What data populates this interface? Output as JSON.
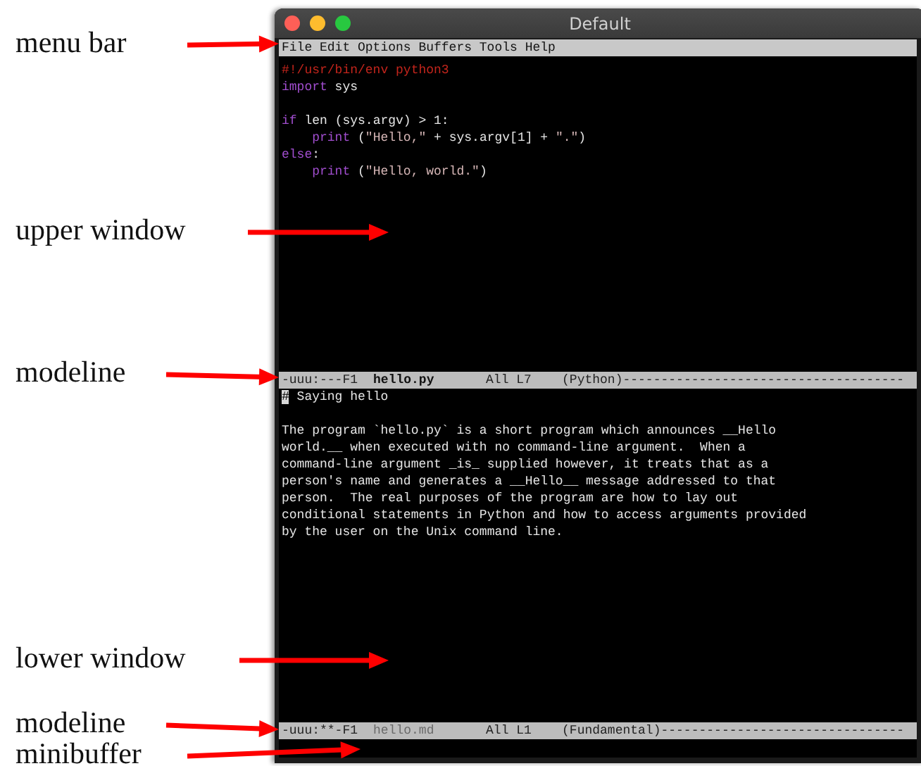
{
  "annotations": [
    {
      "label": "menu bar"
    },
    {
      "label": "upper window"
    },
    {
      "label": "modeline"
    },
    {
      "label": "lower window"
    },
    {
      "label": "modeline"
    },
    {
      "label": "minibuffer"
    }
  ],
  "window": {
    "title": "Default"
  },
  "menu_bar": [
    "File",
    "Edit",
    "Options",
    "Buffers",
    "Tools",
    "Help"
  ],
  "upper_window": {
    "lines": [
      {
        "kind": "code",
        "indent": false,
        "tokens": [
          {
            "kind": "comment",
            "text": "#!/usr/bin/env python3"
          }
        ]
      },
      {
        "kind": "code",
        "indent": false,
        "tokens": [
          {
            "kind": "keyword",
            "text": "import"
          },
          {
            "kind": "plain",
            "text": " sys"
          }
        ]
      },
      {
        "kind": "blank"
      },
      {
        "kind": "code",
        "indent": false,
        "tokens": [
          {
            "kind": "keyword",
            "text": "if"
          },
          {
            "kind": "plain",
            "text": " len (sys.argv) > 1:"
          }
        ]
      },
      {
        "kind": "code",
        "indent": true,
        "tokens": [
          {
            "kind": "keyword",
            "text": "print"
          },
          {
            "kind": "plain",
            "text": " ("
          },
          {
            "kind": "string",
            "text": "\"Hello,\""
          },
          {
            "kind": "plain",
            "text": " + sys.argv[1] + "
          },
          {
            "kind": "string",
            "text": "\".\""
          },
          {
            "kind": "plain",
            "text": ")"
          }
        ]
      },
      {
        "kind": "code",
        "indent": false,
        "tokens": [
          {
            "kind": "keyword",
            "text": "else"
          },
          {
            "kind": "plain",
            "text": ":"
          }
        ]
      },
      {
        "kind": "code",
        "indent": true,
        "tokens": [
          {
            "kind": "keyword",
            "text": "print"
          },
          {
            "kind": "plain",
            "text": " ("
          },
          {
            "kind": "string",
            "text": "\"Hello, world.\""
          },
          {
            "kind": "plain",
            "text": ")"
          }
        ]
      }
    ]
  },
  "upper_modeline": {
    "status": "-uuu:---F1",
    "buffer": "hello.py",
    "active": true,
    "position": "All L7",
    "mode": "(Python)",
    "fill": "-------------------------------------"
  },
  "lower_window": {
    "lines": [
      [
        {
          "text": "#",
          "cursor": true
        },
        {
          "text": " Saying hello",
          "cursor": false
        }
      ],
      [
        {
          "text": "The program `hello.py` is a short program which announces __Hello",
          "cursor": false
        }
      ],
      [
        {
          "text": "world.__ when executed with no command-line argument.  When a",
          "cursor": false
        }
      ],
      [
        {
          "text": "command-line argument _is_ supplied however, it treats that as a",
          "cursor": false
        }
      ],
      [
        {
          "text": "person's name and generates a __Hello__ message addressed to that",
          "cursor": false
        }
      ],
      [
        {
          "text": "person.  The real purposes of the program are how to lay out",
          "cursor": false
        }
      ],
      [
        {
          "text": "conditional statements in Python and how to access arguments provided",
          "cursor": false
        }
      ],
      [
        {
          "text": "by the user on the Unix command line.",
          "cursor": false
        }
      ]
    ]
  },
  "lower_modeline": {
    "status": "-uuu:**-F1",
    "buffer": "hello.md",
    "active": false,
    "position": "All L1",
    "mode": "(Fundamental)",
    "fill": "--------------------------------"
  }
}
